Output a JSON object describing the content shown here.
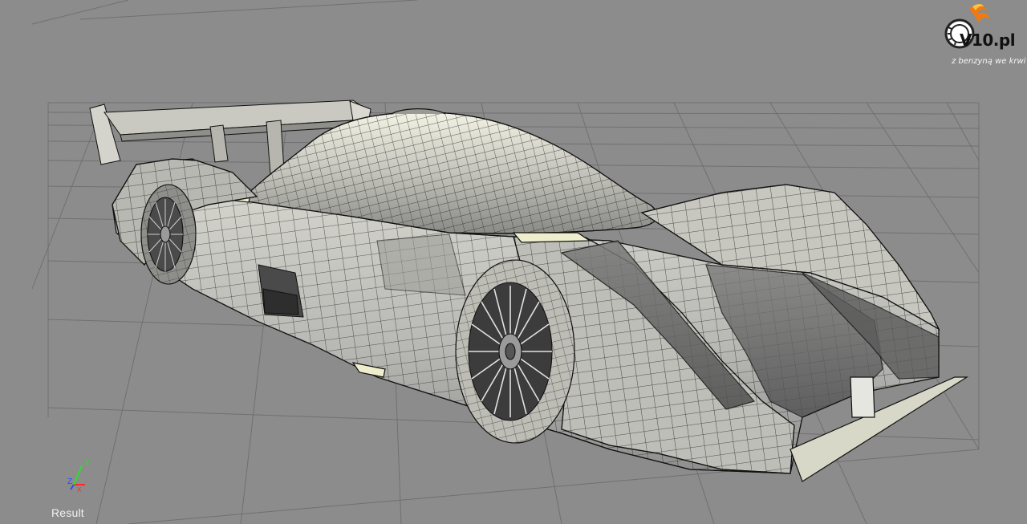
{
  "viewport": {
    "label": "Result"
  },
  "axis_gizmo": {
    "labels": {
      "x": "X",
      "y": "Y",
      "z": "Z"
    },
    "colors": {
      "x": "#ff2a2a",
      "y": "#2adf2a",
      "z": "#2a4aff"
    }
  },
  "logo": {
    "wordmark": "V10.pl",
    "tagline": "z benzyną we krwi",
    "icon": "flame-tire-icon",
    "colors": {
      "flame": "#f07a10",
      "tire": "#222222"
    }
  },
  "scene": {
    "subject": "race-car-wireframe-model",
    "colors": {
      "background": "#8c8c8c",
      "grid_line": "#6e6e6e",
      "surface": "#c8c8c8",
      "surface_light": "#e2e2d6",
      "surface_dark": "#6a6a6a",
      "wire": "#111111",
      "highlight": "#eeeecc"
    }
  }
}
